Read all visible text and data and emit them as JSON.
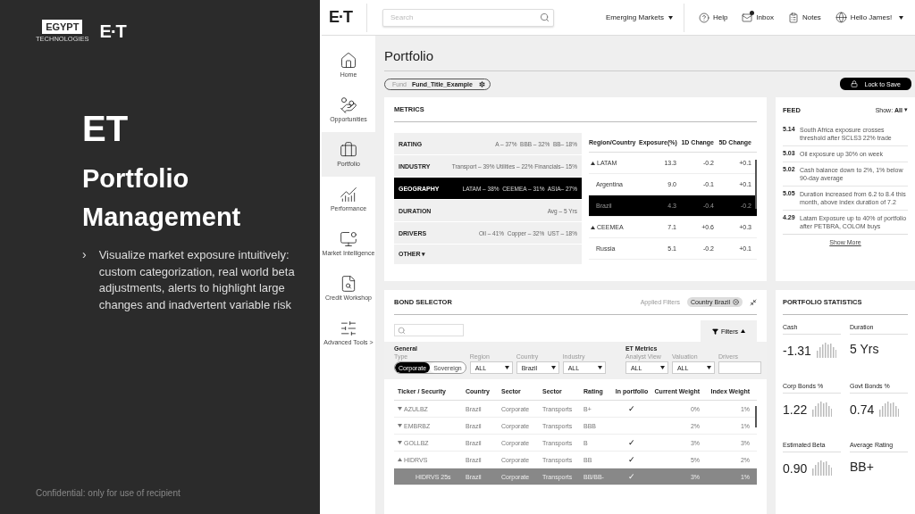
{
  "slide": {
    "logo_box": "EGYPT",
    "logo_sub": "TECHNOLOGIES",
    "logo_mark": "E·T",
    "title": "ET",
    "subtitle": "Portfolio Management",
    "bullet_marker": "›",
    "bullets": [
      "Visualize market exposure intuitively: custom categorization, real world beta adjustments, alerts to highlight large changes and inadvertent variable risk"
    ],
    "footer": "Confidential: only for use of recipient"
  },
  "app": {
    "topbar": {
      "logo": "E·T",
      "search": {
        "placeholder": "Search"
      },
      "market": "Emerging Markets",
      "links": [
        {
          "kind": "help",
          "label": "Help",
          "badge": false
        },
        {
          "kind": "inbox",
          "label": "Inbox",
          "badge": true
        },
        {
          "kind": "notes",
          "label": "Notes",
          "badge": false
        }
      ],
      "user": "Hello James!"
    },
    "sidebar": {
      "items": [
        {
          "kind": "home",
          "label": "Home",
          "selected": false
        },
        {
          "kind": "opportunities",
          "label": "Opportunities",
          "selected": false
        },
        {
          "kind": "portfolio",
          "label": "Portfolio",
          "selected": true
        },
        {
          "kind": "performance",
          "label": "Performance",
          "selected": false
        },
        {
          "kind": "market",
          "label": "Market Intelligence",
          "selected": false
        },
        {
          "kind": "credit",
          "label": "Credit Workshop",
          "selected": false
        },
        {
          "kind": "tools",
          "label": "Advanced Tools >",
          "selected": false
        }
      ]
    },
    "page_title": "Portfolio",
    "fund": {
      "label": "Fund",
      "value": "Fund_Title_Example"
    },
    "lock_button": "Lock to Save",
    "metrics": {
      "title": "METRICS",
      "categories": [
        {
          "name": "RATING",
          "summary": "A – 37%  BBB – 32%  BB– 18%",
          "selected": false
        },
        {
          "name": "INDUSTRY",
          "summary": "Transport – 39% Utilities – 22% Financials– 15%",
          "selected": false
        },
        {
          "name": "GEOGRAPHY",
          "summary": "LATAM – 38%  CEEMEA – 31%  ASIA– 27%",
          "selected": true
        },
        {
          "name": "DURATION",
          "summary": "Avg – 5 Yrs",
          "selected": false
        },
        {
          "name": "DRIVERS",
          "summary": "Oil – 41%  Copper – 32%  UST – 18%",
          "selected": false
        }
      ],
      "other": "OTHER",
      "other_caret": "▾",
      "region_table": {
        "columns": [
          "Region/Country",
          "Exposure(%)",
          "1D Change",
          "5D Change"
        ],
        "rows": [
          {
            "expanded": true,
            "selected": false,
            "cells": [
              "LATAM",
              "13.3",
              "-0.2",
              "+0.1"
            ],
            "children": [
              {
                "selected": false,
                "cells": [
                  "Argentina",
                  "9.0",
                  "-0.1",
                  "+0.1"
                ]
              },
              {
                "selected": true,
                "cells": [
                  "Brazil",
                  "4.3",
                  "-0.4",
                  "-0.2"
                ]
              }
            ]
          },
          {
            "expanded": true,
            "selected": false,
            "cells": [
              "CEEMEA",
              "7.1",
              "+0.6",
              "+0.3"
            ],
            "children": [
              {
                "selected": false,
                "cells": [
                  "Russia",
                  "5.1",
                  "-0.2",
                  "+0.1"
                ]
              }
            ]
          }
        ]
      }
    },
    "feed": {
      "title": "FEED",
      "show": "Show: **All**",
      "show_caret": "▾",
      "items": [
        {
          "date": "5.14",
          "text": "South Africa exposure crosses threshold after SCLS3 22% trade"
        },
        {
          "date": "5.03",
          "text": "Oil exposure up 30% on week"
        },
        {
          "date": "5.02",
          "text": "Cash balance down to 2%, 1% below 90-day average"
        },
        {
          "date": "5.05",
          "text": "Duration increased from 6.2 to 8.4 this month, above index duration of 7.2"
        },
        {
          "date": "4.29",
          "text": "Latam Exposure up to 40% of portfolio after PETBRA, COLOM buys"
        }
      ],
      "more": "Show More"
    },
    "bond_selector": {
      "title": "BOND SELECTOR",
      "applied_label": "Applied Filters",
      "applied": [
        {
          "label": "Country Brazil"
        }
      ],
      "filters_button": "Filters",
      "filters_open": true,
      "groups": [
        {
          "title": "General",
          "fields": [
            {
              "kind": "toggle",
              "label": "Type",
              "options": [
                {
                  "label": "Corporate",
                  "selected": true
                },
                {
                  "label": "Sovereign",
                  "selected": false
                }
              ]
            },
            {
              "kind": "select",
              "label": "Region",
              "value": "ALL"
            },
            {
              "kind": "select",
              "label": "Country",
              "value": "Brazil"
            },
            {
              "kind": "select",
              "label": "Industry",
              "value": "ALL"
            }
          ]
        },
        {
          "title": "ET Metrics",
          "fields": [
            {
              "kind": "select",
              "label": "Analyst View",
              "value": "ALL"
            },
            {
              "kind": "select",
              "label": "Valuation",
              "value": "ALL"
            },
            {
              "kind": "text",
              "label": "Drivers"
            }
          ]
        }
      ],
      "columns": [
        "Ticker / Security",
        "Country",
        "Sector",
        "Sector",
        "Rating",
        "In portfolio",
        "Current Weight",
        "Index Weight"
      ],
      "rows": [
        {
          "expanded": false,
          "selected": false,
          "cells": [
            "AZULBZ",
            "Brazil",
            "Corporate",
            "Transports",
            "B+",
            "✓",
            "0%",
            "1%"
          ]
        },
        {
          "expanded": false,
          "selected": false,
          "cells": [
            "EMBRBZ",
            "Brazil",
            "Corporate",
            "Transports",
            "BBB",
            "",
            "2%",
            "1%"
          ]
        },
        {
          "expanded": false,
          "selected": false,
          "cells": [
            "GOLLBZ",
            "Brazil",
            "Corporate",
            "Transports",
            "B",
            "✓",
            "3%",
            "3%"
          ]
        },
        {
          "expanded": true,
          "selected": false,
          "cells": [
            "HIDRVS",
            "Brazil",
            "Corporate",
            "Transports",
            "BB",
            "✓",
            "5%",
            "2%"
          ],
          "children": [
            {
              "selected": true,
              "cells": [
                "HIDRVS 25s",
                "Brazil",
                "Corporate",
                "Transports",
                "BB/BB-",
                "✓",
                "3%",
                "1%"
              ]
            }
          ]
        }
      ]
    },
    "statistics": {
      "title": "PORTFOLIO STATISTICS",
      "items": [
        {
          "label": "Cash",
          "value": "-1.31",
          "sparkline": true
        },
        {
          "label": "Duration",
          "value": "5 Yrs",
          "sparkline": false
        },
        {
          "label": "Corp Bonds %",
          "value": "1.22",
          "sparkline": true
        },
        {
          "label": "Govt Bonds %",
          "value": "0.74",
          "sparkline": true
        },
        {
          "label": "Estimated Beta",
          "value": "0.90",
          "sparkline": true
        },
        {
          "label": "Average Rating",
          "value": "BB+",
          "sparkline": false
        }
      ]
    }
  }
}
